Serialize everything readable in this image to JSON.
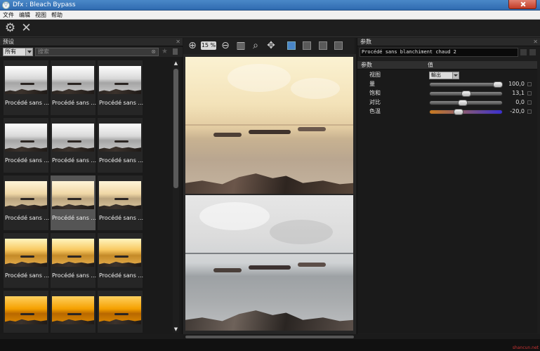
{
  "window": {
    "title": "Dfx : Bleach Bypass"
  },
  "menu": [
    "文件",
    "编辑",
    "视图",
    "帮助"
  ],
  "toolbar": {
    "icons": [
      "gear-icon",
      "close-x-icon"
    ]
  },
  "left_panel": {
    "title": "预设",
    "filter_selected": "所有",
    "search_placeholder": "搜索",
    "tiles": [
      {
        "label": "Procédé sans ...",
        "tone": "bw"
      },
      {
        "label": "Procédé sans ...",
        "tone": "bw"
      },
      {
        "label": "Procédé sans ...",
        "tone": "bw"
      },
      {
        "label": "Procédé sans ...",
        "tone": "bw"
      },
      {
        "label": "Procédé sans ...",
        "tone": "bw"
      },
      {
        "label": "Procédé sans ...",
        "tone": "bw"
      },
      {
        "label": "Procédé sans ...",
        "tone": "warm"
      },
      {
        "label": "Procédé sans ...",
        "tone": "warm",
        "selected": true
      },
      {
        "label": "Procédé sans ...",
        "tone": "warm"
      },
      {
        "label": "Procédé sans ...",
        "tone": "orange"
      },
      {
        "label": "Procédé sans ...",
        "tone": "orange"
      },
      {
        "label": "Procédé sans ...",
        "tone": "orange"
      },
      {
        "label": "",
        "tone": "fire"
      },
      {
        "label": "",
        "tone": "fire"
      },
      {
        "label": "",
        "tone": "fire"
      }
    ]
  },
  "center": {
    "zoom": "15 %"
  },
  "right_panel": {
    "title": "参数",
    "preset_name": "Procédé sans blanchiment chaud 2",
    "columns": {
      "param": "参数",
      "value": "值"
    },
    "rows": [
      {
        "name": "视图",
        "type": "dropdown",
        "value": "輸出"
      },
      {
        "name": "量",
        "type": "slider",
        "value": "100,0",
        "level": 1.0
      },
      {
        "name": "饱和",
        "type": "slider",
        "value": "13,1",
        "level": 0.5
      },
      {
        "name": "对比",
        "type": "slider",
        "value": "0,0",
        "level": 0.45
      },
      {
        "name": "色温",
        "type": "color-slider",
        "value": "-20,0",
        "level": 0.38
      }
    ]
  },
  "watermark": "shancun.net"
}
